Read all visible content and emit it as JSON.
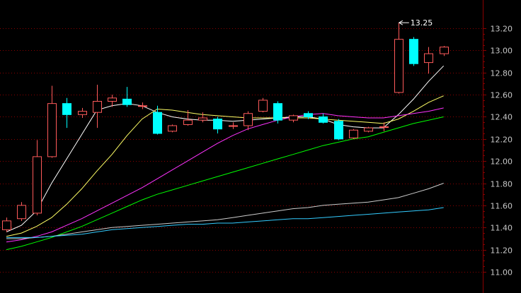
{
  "top_tabs": [
    "",
    "",
    "",
    ""
  ],
  "colors": {
    "background": "#000000",
    "grid": "#8b0000",
    "axis_text": "#c8c8c8",
    "up_candle": "#ff5a5a",
    "down_candle": "#00ffff",
    "ma5": "#ffffff",
    "ma10": "#ffff66",
    "ma20": "#ff33ff",
    "ma30": "#00ff00",
    "ma60": "#cccccc",
    "ma120": "#33ccff"
  },
  "chart_data": {
    "type": "candlestick",
    "title": "",
    "ylim": [
      10.92,
      13.3
    ],
    "ticks": [
      11.0,
      11.2,
      11.4,
      11.6,
      11.8,
      12.0,
      12.2,
      12.4,
      12.6,
      12.8,
      13.0,
      13.2
    ],
    "tick_labels": [
      "11.00",
      "11.20",
      "11.40",
      "11.60",
      "11.80",
      "12.00",
      "12.20",
      "12.40",
      "12.60",
      "12.80",
      "13.00",
      "13.20"
    ],
    "grid": true,
    "annotation": {
      "text": "13.25",
      "candle_index": 26
    },
    "candles": [
      {
        "o": 11.38,
        "c": 11.46,
        "h": 11.49,
        "l": 11.36
      },
      {
        "o": 11.48,
        "c": 11.6,
        "h": 11.63,
        "l": 11.46
      },
      {
        "o": 11.53,
        "c": 12.04,
        "h": 12.19,
        "l": 11.51
      },
      {
        "o": 12.04,
        "c": 12.52,
        "h": 12.68,
        "l": 12.03
      },
      {
        "o": 12.52,
        "c": 12.42,
        "h": 12.57,
        "l": 12.3
      },
      {
        "o": 12.42,
        "c": 12.45,
        "h": 12.48,
        "l": 12.39
      },
      {
        "o": 12.44,
        "c": 12.54,
        "h": 12.69,
        "l": 12.3
      },
      {
        "o": 12.54,
        "c": 12.57,
        "h": 12.6,
        "l": 12.49
      },
      {
        "o": 12.56,
        "c": 12.51,
        "h": 12.67,
        "l": 12.49
      },
      {
        "o": 12.5,
        "c": 12.5,
        "h": 12.53,
        "l": 12.47
      },
      {
        "o": 12.44,
        "c": 12.25,
        "h": 12.5,
        "l": 12.24
      },
      {
        "o": 12.27,
        "c": 12.32,
        "h": 12.33,
        "l": 12.26
      },
      {
        "o": 12.33,
        "c": 12.37,
        "h": 12.46,
        "l": 12.32
      },
      {
        "o": 12.37,
        "c": 12.39,
        "h": 12.44,
        "l": 12.35
      },
      {
        "o": 12.38,
        "c": 12.29,
        "h": 12.4,
        "l": 12.25
      },
      {
        "o": 12.32,
        "c": 12.32,
        "h": 12.35,
        "l": 12.29
      },
      {
        "o": 12.32,
        "c": 12.43,
        "h": 12.45,
        "l": 12.28
      },
      {
        "o": 12.45,
        "c": 12.55,
        "h": 12.57,
        "l": 12.44
      },
      {
        "o": 12.52,
        "c": 12.37,
        "h": 12.54,
        "l": 12.34
      },
      {
        "o": 12.37,
        "c": 12.41,
        "h": 12.42,
        "l": 12.35
      },
      {
        "o": 12.43,
        "c": 12.4,
        "h": 12.45,
        "l": 12.38
      },
      {
        "o": 12.4,
        "c": 12.35,
        "h": 12.43,
        "l": 12.34
      },
      {
        "o": 12.36,
        "c": 12.2,
        "h": 12.38,
        "l": 12.19
      },
      {
        "o": 12.21,
        "c": 12.28,
        "h": 12.29,
        "l": 12.2
      },
      {
        "o": 12.27,
        "c": 12.3,
        "h": 12.31,
        "l": 12.26
      },
      {
        "o": 12.31,
        "c": 12.31,
        "h": 12.35,
        "l": 12.27
      },
      {
        "o": 12.62,
        "c": 13.1,
        "h": 13.25,
        "l": 12.61
      },
      {
        "o": 13.1,
        "c": 12.88,
        "h": 13.12,
        "l": 12.86
      },
      {
        "o": 12.89,
        "c": 12.97,
        "h": 13.03,
        "l": 12.79
      },
      {
        "o": 12.97,
        "c": 13.03,
        "h": 13.04,
        "l": 12.95
      }
    ],
    "moving_averages": [
      {
        "key": "ma5",
        "x_start": 0,
        "values": [
          11.36,
          11.42,
          11.55,
          11.8,
          12.02,
          12.24,
          12.46,
          12.5,
          12.52,
          12.5,
          12.44,
          12.4,
          12.38,
          12.37,
          12.37,
          12.36,
          12.37,
          12.38,
          12.39,
          12.4,
          12.4,
          12.38,
          12.33,
          12.31,
          12.3,
          12.3,
          12.42,
          12.56,
          12.72,
          12.86
        ]
      },
      {
        "key": "ma10",
        "x_start": 0,
        "values": [
          11.32,
          11.35,
          11.41,
          11.49,
          11.61,
          11.75,
          11.91,
          12.06,
          12.23,
          12.38,
          12.47,
          12.46,
          12.44,
          12.42,
          12.41,
          12.4,
          12.39,
          12.39,
          12.39,
          12.39,
          12.39,
          12.38,
          12.37,
          12.36,
          12.35,
          12.34,
          12.38,
          12.45,
          12.53,
          12.59
        ]
      },
      {
        "key": "ma20",
        "x_start": 0,
        "values": [
          11.27,
          11.29,
          11.32,
          11.36,
          11.42,
          11.48,
          11.55,
          11.62,
          11.69,
          11.76,
          11.84,
          11.92,
          12.0,
          12.08,
          12.16,
          12.23,
          12.29,
          12.33,
          12.37,
          12.4,
          12.42,
          12.43,
          12.41,
          12.4,
          12.39,
          12.39,
          12.41,
          12.43,
          12.45,
          12.48
        ]
      },
      {
        "key": "ma30",
        "x_start": 0,
        "values": [
          11.2,
          11.23,
          11.27,
          11.31,
          11.36,
          11.41,
          11.47,
          11.53,
          11.59,
          11.65,
          11.7,
          11.74,
          11.78,
          11.82,
          11.86,
          11.9,
          11.94,
          11.98,
          12.02,
          12.06,
          12.1,
          12.14,
          12.17,
          12.2,
          12.22,
          12.26,
          12.3,
          12.34,
          12.37,
          12.4
        ]
      },
      {
        "key": "ma60",
        "x_start": 0,
        "values": [
          11.3,
          11.3,
          11.31,
          11.32,
          11.34,
          11.36,
          11.38,
          11.4,
          11.41,
          11.42,
          11.43,
          11.44,
          11.45,
          11.46,
          11.47,
          11.49,
          11.51,
          11.53,
          11.55,
          11.57,
          11.58,
          11.6,
          11.61,
          11.62,
          11.63,
          11.65,
          11.67,
          11.71,
          11.75,
          11.8
        ]
      },
      {
        "key": "ma120",
        "x_start": 0,
        "values": [
          11.31,
          11.31,
          11.31,
          11.32,
          11.33,
          11.34,
          11.36,
          11.38,
          11.39,
          11.4,
          11.41,
          11.42,
          11.43,
          11.43,
          11.44,
          11.44,
          11.45,
          11.46,
          11.47,
          11.48,
          11.48,
          11.49,
          11.5,
          11.51,
          11.52,
          11.53,
          11.54,
          11.55,
          11.56,
          11.58
        ]
      }
    ]
  }
}
